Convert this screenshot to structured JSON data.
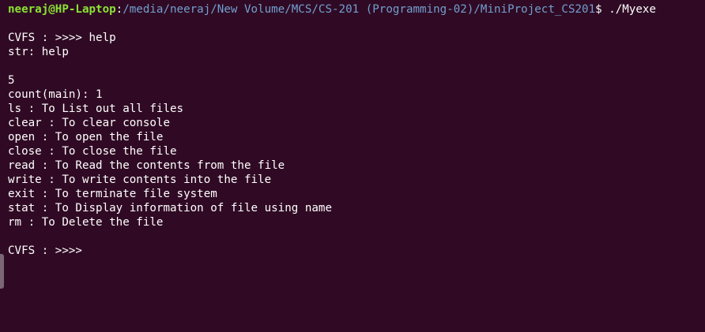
{
  "prompt": {
    "user_host": "neeraj@HP-Laptop",
    "separator": ":",
    "path": "/media/neeraj/New Volume/MCS/CS-201 (Programming-02)/MiniProject_CS201",
    "symbol": "$",
    "command": " ./Myexe"
  },
  "output": [
    "",
    "CVFS : >>>> help",
    "str: help",
    "",
    "5",
    "count(main): 1",
    "ls : To List out all files",
    "clear : To clear console",
    "open : To open the file",
    "close : To close the file",
    "read : To Read the contents from the file",
    "write : To write contents into the file",
    "exit : To terminate file system",
    "stat : To Display information of file using name",
    "rm : To Delete the file",
    "",
    "CVFS : >>>> "
  ],
  "colors": {
    "background": "#300a24",
    "user_host": "#8ae234",
    "path": "#729fcf",
    "text": "#ffffff"
  }
}
